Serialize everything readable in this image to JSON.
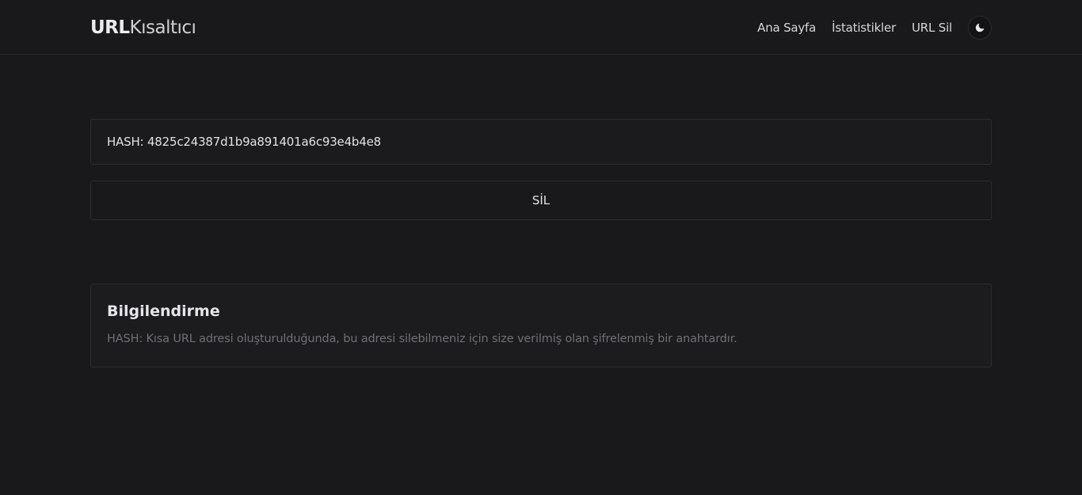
{
  "header": {
    "brand_bold": "URL",
    "brand_light": "Kısaltıcı",
    "nav": {
      "home": "Ana Sayfa",
      "stats": "İstatistikler",
      "delete_url": "URL Sil"
    },
    "theme_icon": "moon-icon"
  },
  "main": {
    "hash_value": "HASH: 4825c24387d1b9a891401a6c93e4b4e8",
    "delete_label": "SİL"
  },
  "info": {
    "title": "Bilgilendirme",
    "text": "HASH: Kısa URL adresi oluşturulduğunda, bu adresi silebilmeniz için size verilmiş olan şifrelenmiş bir anahtardır."
  }
}
